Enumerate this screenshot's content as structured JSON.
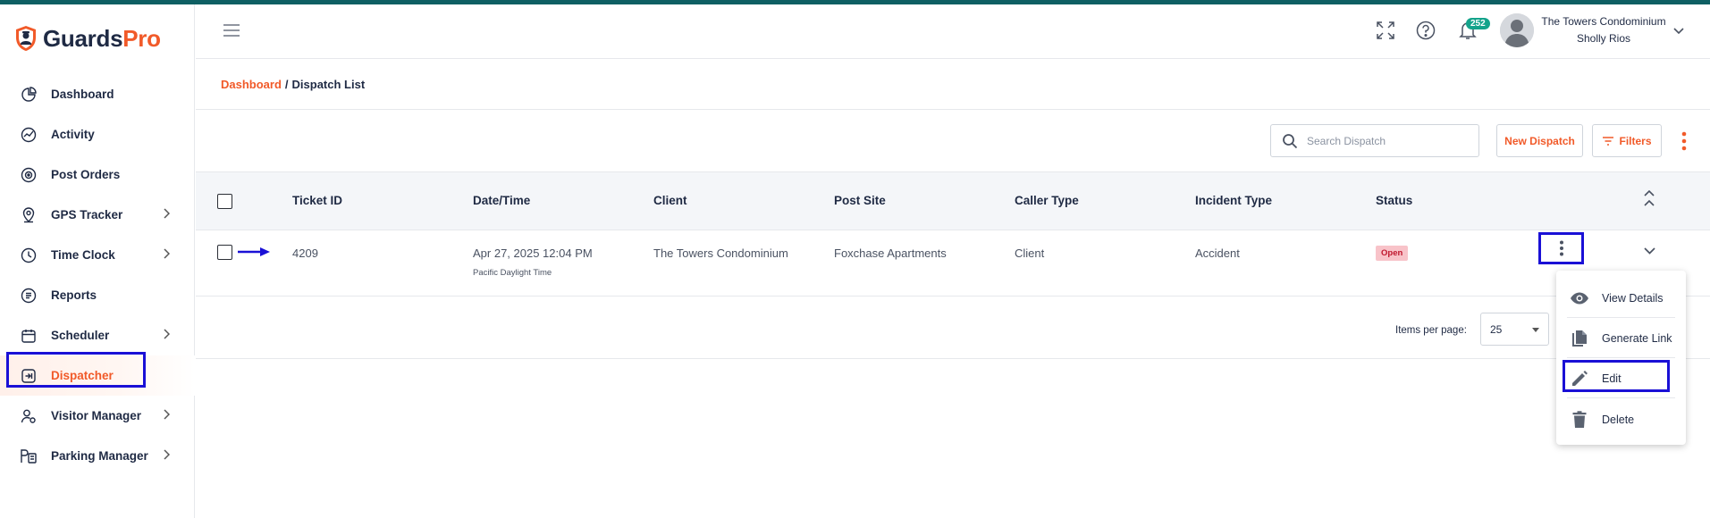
{
  "brand": {
    "part1": "Guards",
    "part2": "Pro"
  },
  "sidebar": {
    "items": [
      {
        "label": "Dashboard",
        "icon": "pie-chart-icon",
        "chevron": false
      },
      {
        "label": "Activity",
        "icon": "activity-icon",
        "chevron": false
      },
      {
        "label": "Post Orders",
        "icon": "post-orders-icon",
        "chevron": false
      },
      {
        "label": "GPS Tracker",
        "icon": "location-pin-icon",
        "chevron": true
      },
      {
        "label": "Time Clock",
        "icon": "clock-icon",
        "chevron": true
      },
      {
        "label": "Reports",
        "icon": "reports-icon",
        "chevron": false
      },
      {
        "label": "Scheduler",
        "icon": "calendar-icon",
        "chevron": true
      },
      {
        "label": "Dispatcher",
        "icon": "dispatcher-icon",
        "chevron": false,
        "active": true
      },
      {
        "label": "Visitor Manager",
        "icon": "visitor-icon",
        "chevron": true
      },
      {
        "label": "Parking Manager",
        "icon": "parking-icon",
        "chevron": true
      }
    ]
  },
  "header": {
    "notification_count": "252",
    "user_title": "The Towers Condominium",
    "user_name": "Sholly Rios"
  },
  "breadcrumb": {
    "home": "Dashboard",
    "separator": "/",
    "current": "Dispatch List"
  },
  "toolbar": {
    "search_placeholder": "Search Dispatch",
    "new_button": "New Dispatch",
    "filters_button": "Filters"
  },
  "table": {
    "columns": [
      "Ticket ID",
      "Date/Time",
      "Client",
      "Post Site",
      "Caller Type",
      "Incident Type",
      "Status"
    ],
    "rows": [
      {
        "ticket_id": "4209",
        "date_time": "Apr 27, 2025 12:04 PM",
        "timezone": "Pacific Daylight Time",
        "client": "The Towers Condominium",
        "post_site": "Foxchase Apartments",
        "caller_type": "Client",
        "incident_type": "Accident",
        "status": "Open"
      }
    ]
  },
  "pagination": {
    "items_per_page_label": "Items per page:",
    "items_per_page_value": "25"
  },
  "context_menu": {
    "items": [
      {
        "label": "View Details",
        "icon": "eye-icon"
      },
      {
        "label": "Generate Link",
        "icon": "document-link-icon"
      },
      {
        "label": "Edit",
        "icon": "pencil-icon"
      },
      {
        "label": "Delete",
        "icon": "trash-icon"
      }
    ]
  },
  "colors": {
    "accent": "#f15a29",
    "highlight": "#1a10d6",
    "badge": "#14a38b",
    "status_open_bg": "#f8c3c9",
    "top_stripe": "#0f5f63"
  }
}
